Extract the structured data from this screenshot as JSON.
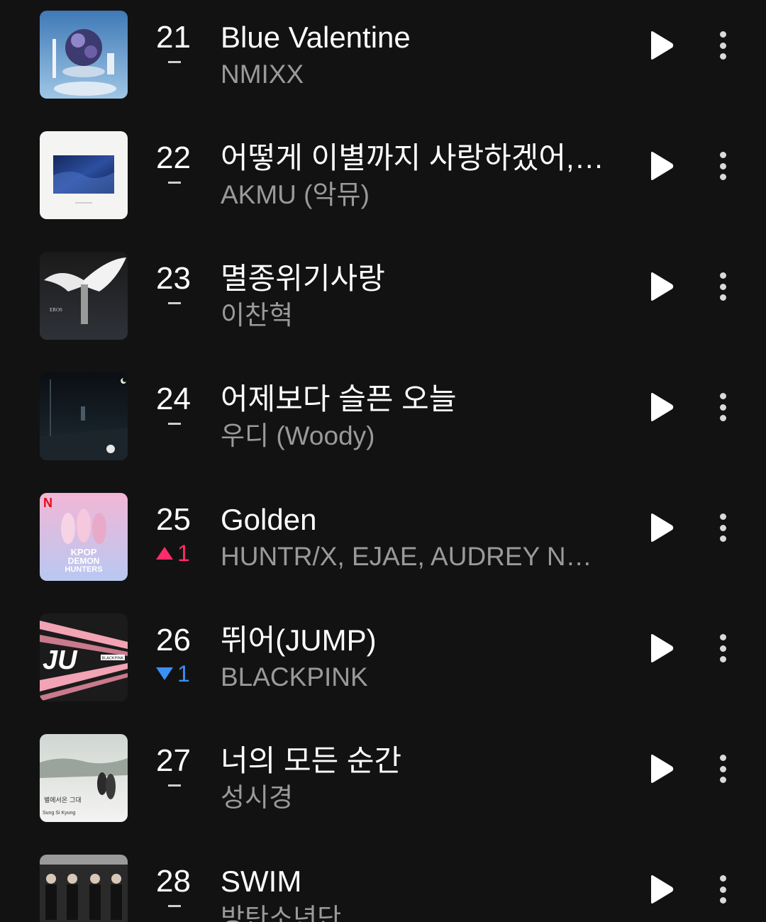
{
  "chart_list": {
    "rows": [
      {
        "rank": "21",
        "change": "",
        "change_dir": "none",
        "title": "Blue Valentine",
        "artist": "NMIXX",
        "art_icon": "album-cover-nmixx"
      },
      {
        "rank": "22",
        "change": "",
        "change_dir": "none",
        "title": "어떻게 이별까지 사랑하겠어, 널 사랑하는 거지",
        "artist": "AKMU (악뮤)",
        "art_icon": "album-cover-akmu"
      },
      {
        "rank": "23",
        "change": "",
        "change_dir": "none",
        "title": "멸종위기사랑",
        "artist": "이찬혁",
        "art_icon": "album-cover-eros"
      },
      {
        "rank": "24",
        "change": "",
        "change_dir": "none",
        "title": "어제보다 슬픈 오늘",
        "artist": "우디 (Woody)",
        "art_icon": "album-cover-woody"
      },
      {
        "rank": "25",
        "change": "1",
        "change_dir": "up",
        "title": "Golden",
        "artist": "HUNTR/X, EJAE, AUDREY NUNA, REI AMI",
        "art_icon": "album-cover-kpop-demon-hunters"
      },
      {
        "rank": "26",
        "change": "1",
        "change_dir": "down",
        "title": "뛰어(JUMP)",
        "artist": "BLACKPINK",
        "art_icon": "album-cover-jump"
      },
      {
        "rank": "27",
        "change": "",
        "change_dir": "none",
        "title": "너의 모든 순간",
        "artist": "성시경",
        "art_icon": "album-cover-sung-si-kyung"
      },
      {
        "rank": "28",
        "change": "",
        "change_dir": "none",
        "title": "SWIM",
        "artist": "방탄소년단",
        "art_icon": "album-cover-bts"
      }
    ],
    "cover_text": {
      "golden_line1": "KPOP",
      "golden_line2": "DEMON",
      "golden_line3": "HUNTERS",
      "netflix_mark": "N",
      "eros": "EROS",
      "jump": "JU",
      "jump_tag": "BLACKPINK",
      "ssk_title": "별에서온 그대",
      "ssk_name": "Sung Si Kyung"
    }
  },
  "colors": {
    "background": "#121212",
    "rank_up": "#ff2b6a",
    "rank_down": "#3b8ff5",
    "secondary_text": "#9a9a9a"
  }
}
